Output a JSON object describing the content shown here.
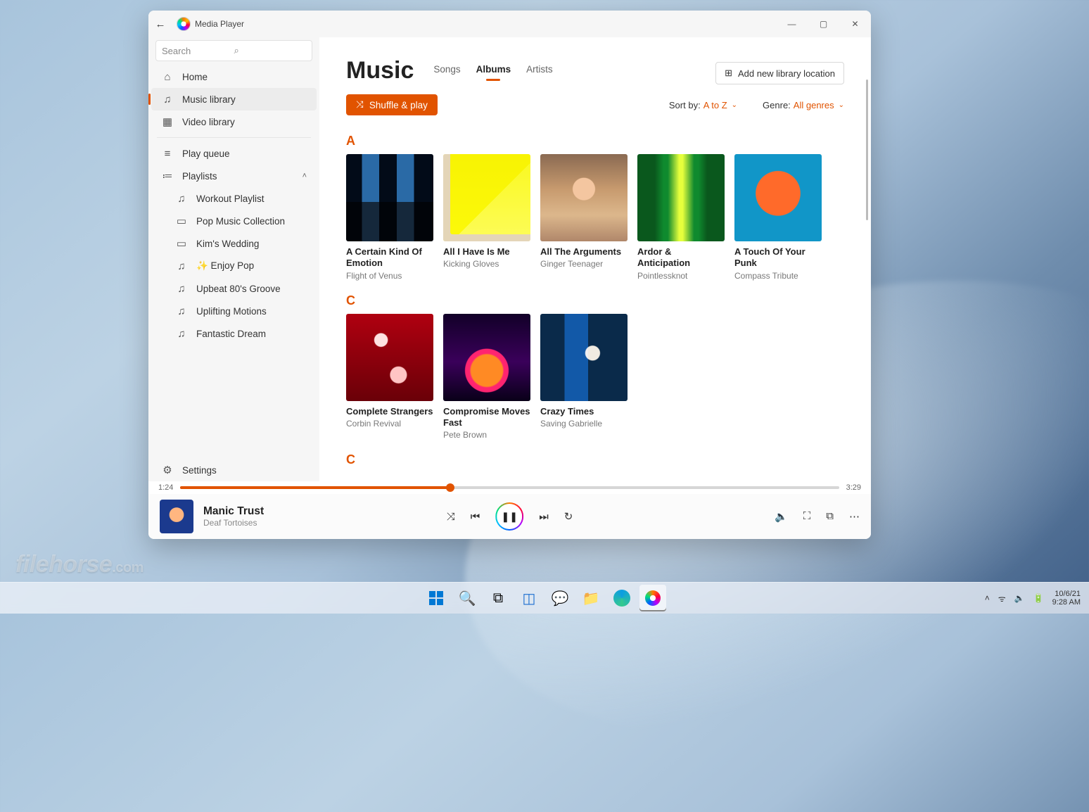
{
  "titlebar": {
    "app_name": "Media Player"
  },
  "search": {
    "placeholder": "Search"
  },
  "sidebar": {
    "home": "Home",
    "music_library": "Music library",
    "video_library": "Video library",
    "play_queue": "Play queue",
    "playlists_label": "Playlists",
    "playlists": [
      "Workout Playlist",
      "Pop Music Collection",
      "Kim's Wedding",
      "✨ Enjoy Pop",
      "Upbeat 80's Groove",
      "Uplifting Motions",
      "Fantastic Dream"
    ],
    "settings": "Settings"
  },
  "page": {
    "title": "Music",
    "tabs": {
      "songs": "Songs",
      "albums": "Albums",
      "artists": "Artists"
    },
    "add_location": "Add new library location",
    "shuffle_play": "Shuffle & play",
    "sort_by_label": "Sort by:",
    "sort_by_value": "A to Z",
    "genre_label": "Genre:",
    "genre_value": "All genres"
  },
  "sections": {
    "A": [
      {
        "title": "A Certain Kind Of Emotion",
        "artist": "Flight of Venus"
      },
      {
        "title": "All I Have Is Me",
        "artist": "Kicking Gloves"
      },
      {
        "title": "All The Arguments",
        "artist": "Ginger Teenager"
      },
      {
        "title": "Ardor & Anticipation",
        "artist": "Pointlessknot"
      },
      {
        "title": "A Touch Of Your Punk",
        "artist": "Compass Tribute"
      }
    ],
    "C": [
      {
        "title": "Complete Strangers",
        "artist": "Corbin Revival"
      },
      {
        "title": "Compromise Moves Fast",
        "artist": "Pete Brown"
      },
      {
        "title": "Crazy Times",
        "artist": "Saving Gabrielle"
      }
    ]
  },
  "section_letters": {
    "a": "A",
    "c1": "C",
    "c2": "C"
  },
  "player": {
    "elapsed": "1:24",
    "duration": "3:29",
    "now_title": "Manic Trust",
    "now_artist": "Deaf Tortoises"
  },
  "taskbar": {
    "date": "10/6/21",
    "time": "9:28 AM"
  },
  "watermark": {
    "brand": "filehorse",
    "tld": ".com"
  }
}
